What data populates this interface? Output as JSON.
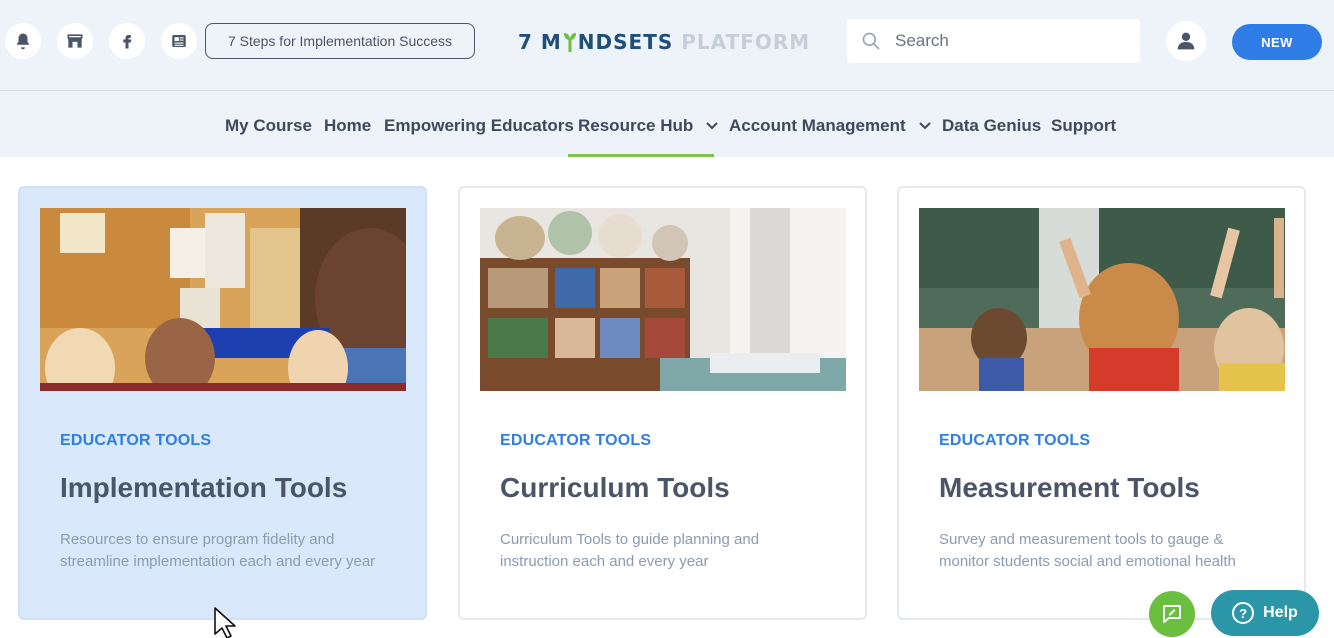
{
  "header": {
    "icons": [
      "bell-icon",
      "store-icon",
      "facebook-icon",
      "news-icon"
    ],
    "steps_button": "7 Steps for Implementation Success",
    "logo": {
      "part1_a": "7 M",
      "part1_b": "NDSETS",
      "part2": "PLATFORM"
    },
    "search": {
      "placeholder": "Search",
      "value": ""
    },
    "new_button": "NEW"
  },
  "nav": {
    "items": [
      {
        "label": "My Course"
      },
      {
        "label": "Home"
      },
      {
        "label": "Empowering Educators"
      },
      {
        "label": "Resource Hub",
        "dropdown": true,
        "active": true
      },
      {
        "label": "Account Management",
        "dropdown": true
      },
      {
        "label": "Data Genius"
      },
      {
        "label": "Support"
      }
    ]
  },
  "cards": [
    {
      "eyebrow": "EDUCATOR TOOLS",
      "title": "Implementation Tools",
      "description": "Resources to ensure program fidelity and streamline implementation each and every year",
      "image": "teacher-with-students-photo"
    },
    {
      "eyebrow": "EDUCATOR TOOLS",
      "title": "Curriculum Tools",
      "description": "Curriculum Tools to guide planning and instruction each and every year",
      "image": "classroom-shelves-photo"
    },
    {
      "eyebrow": "EDUCATOR TOOLS",
      "title": "Measurement Tools",
      "description": "Survey and measurement tools to gauge & monitor students social and emotional health",
      "image": "students-raising-hands-photo"
    }
  ],
  "floating": {
    "help_label": "Help",
    "help_glyph": "?"
  },
  "colors": {
    "accent_blue": "#2f7de6",
    "accent_green": "#7ec24a",
    "help_teal": "#2a96a8",
    "header_bg": "#eef2f9"
  }
}
